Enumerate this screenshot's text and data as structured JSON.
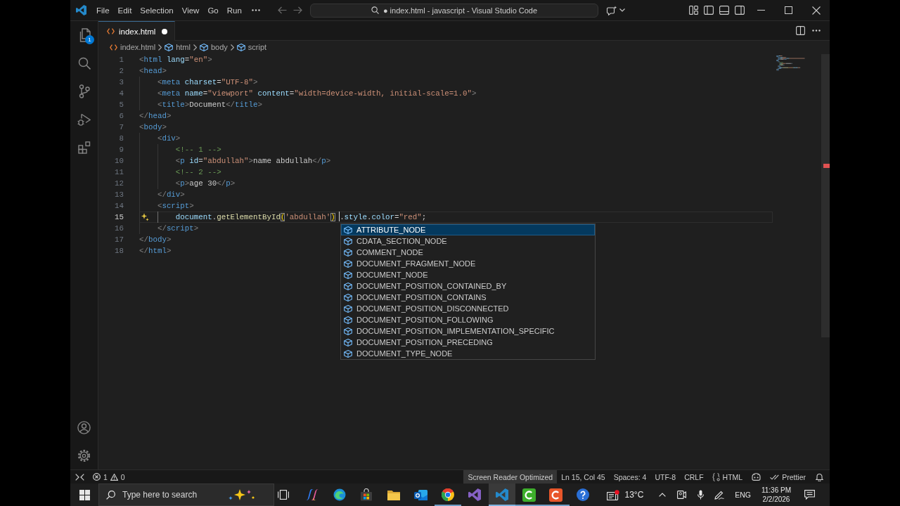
{
  "window": {
    "title": "● index.html - javascript - Visual Studio Code",
    "menu": [
      "File",
      "Edit",
      "Selection",
      "View",
      "Go",
      "Run"
    ]
  },
  "activity_bar": {
    "explorer_badge": "1"
  },
  "tabs": [
    {
      "label": "index.html",
      "selected": true,
      "modified": true
    }
  ],
  "breadcrumbs": [
    {
      "kind": "file",
      "label": "index.html"
    },
    {
      "kind": "element",
      "label": "html"
    },
    {
      "kind": "element",
      "label": "body"
    },
    {
      "kind": "element",
      "label": "script"
    }
  ],
  "editor": {
    "lines": [
      {
        "number": "1",
        "current": false,
        "code_action": false,
        "tokens": [
          {
            "kind": "punct",
            "text": "<"
          },
          {
            "kind": "tag",
            "text": "html"
          },
          {
            "kind": "attr",
            "text": " lang"
          },
          {
            "kind": "plain",
            "text": "="
          },
          {
            "kind": "string",
            "text": "\"en\""
          },
          {
            "kind": "punct",
            "text": ">"
          }
        ]
      },
      {
        "number": "2",
        "current": false,
        "code_action": false,
        "tokens": [
          {
            "kind": "punct",
            "text": "<"
          },
          {
            "kind": "tag",
            "text": "head"
          },
          {
            "kind": "punct",
            "text": ">"
          }
        ]
      },
      {
        "number": "3",
        "current": false,
        "code_action": false,
        "tokens": [
          {
            "kind": "punct",
            "text": "    <"
          },
          {
            "kind": "tag",
            "text": "meta"
          },
          {
            "kind": "attr",
            "text": " charset"
          },
          {
            "kind": "plain",
            "text": "="
          },
          {
            "kind": "string",
            "text": "\"UTF-8\""
          },
          {
            "kind": "punct",
            "text": ">"
          }
        ]
      },
      {
        "number": "4",
        "current": false,
        "code_action": false,
        "tokens": [
          {
            "kind": "punct",
            "text": "    <"
          },
          {
            "kind": "tag",
            "text": "meta"
          },
          {
            "kind": "attr",
            "text": " name"
          },
          {
            "kind": "plain",
            "text": "="
          },
          {
            "kind": "string",
            "text": "\"viewport\""
          },
          {
            "kind": "attr",
            "text": " content"
          },
          {
            "kind": "plain",
            "text": "="
          },
          {
            "kind": "string",
            "text": "\"width=device-width, initial-scale=1.0\""
          },
          {
            "kind": "punct",
            "text": ">"
          }
        ]
      },
      {
        "number": "5",
        "current": false,
        "code_action": false,
        "tokens": [
          {
            "kind": "punct",
            "text": "    <"
          },
          {
            "kind": "tag",
            "text": "title"
          },
          {
            "kind": "punct",
            "text": ">"
          },
          {
            "kind": "plain",
            "text": "Document"
          },
          {
            "kind": "punct",
            "text": "</"
          },
          {
            "kind": "tag",
            "text": "title"
          },
          {
            "kind": "punct",
            "text": ">"
          }
        ]
      },
      {
        "number": "6",
        "current": false,
        "code_action": false,
        "tokens": [
          {
            "kind": "punct",
            "text": "</"
          },
          {
            "kind": "tag",
            "text": "head"
          },
          {
            "kind": "punct",
            "text": ">"
          }
        ]
      },
      {
        "number": "7",
        "current": false,
        "code_action": false,
        "tokens": [
          {
            "kind": "punct",
            "text": "<"
          },
          {
            "kind": "tag",
            "text": "body"
          },
          {
            "kind": "punct",
            "text": ">"
          }
        ]
      },
      {
        "number": "8",
        "current": false,
        "code_action": false,
        "tokens": [
          {
            "kind": "punct",
            "text": "    <"
          },
          {
            "kind": "tag",
            "text": "div"
          },
          {
            "kind": "punct",
            "text": ">"
          }
        ]
      },
      {
        "number": "9",
        "current": false,
        "code_action": false,
        "tokens": [
          {
            "kind": "comment",
            "text": "        <!-- 1 -->"
          }
        ]
      },
      {
        "number": "10",
        "current": false,
        "code_action": false,
        "tokens": [
          {
            "kind": "punct",
            "text": "        <"
          },
          {
            "kind": "tag",
            "text": "p"
          },
          {
            "kind": "attr",
            "text": " id"
          },
          {
            "kind": "plain",
            "text": "="
          },
          {
            "kind": "string",
            "text": "\"abdullah\""
          },
          {
            "kind": "punct",
            "text": ">"
          },
          {
            "kind": "plain",
            "text": "name abdullah"
          },
          {
            "kind": "punct",
            "text": "</"
          },
          {
            "kind": "tag",
            "text": "p"
          },
          {
            "kind": "punct",
            "text": ">"
          }
        ]
      },
      {
        "number": "11",
        "current": false,
        "code_action": false,
        "tokens": [
          {
            "kind": "comment",
            "text": "        <!-- 2 -->"
          }
        ]
      },
      {
        "number": "12",
        "current": false,
        "code_action": false,
        "tokens": [
          {
            "kind": "punct",
            "text": "        <"
          },
          {
            "kind": "tag",
            "text": "p"
          },
          {
            "kind": "punct",
            "text": ">"
          },
          {
            "kind": "plain",
            "text": "age 30"
          },
          {
            "kind": "punct",
            "text": "</"
          },
          {
            "kind": "tag",
            "text": "p"
          },
          {
            "kind": "punct",
            "text": ">"
          }
        ]
      },
      {
        "number": "13",
        "current": false,
        "code_action": false,
        "tokens": [
          {
            "kind": "punct",
            "text": "    </"
          },
          {
            "kind": "tag",
            "text": "div"
          },
          {
            "kind": "punct",
            "text": ">"
          }
        ]
      },
      {
        "number": "14",
        "current": false,
        "code_action": false,
        "tokens": [
          {
            "kind": "punct",
            "text": "    <"
          },
          {
            "kind": "tag",
            "text": "script"
          },
          {
            "kind": "punct",
            "text": ">"
          }
        ]
      },
      {
        "number": "15",
        "current": true,
        "code_action": true,
        "tokens": [
          {
            "kind": "var",
            "text": "        document"
          },
          {
            "kind": "plain",
            "text": "."
          },
          {
            "kind": "func",
            "text": "getElementById"
          },
          {
            "kind": "match",
            "text": "("
          },
          {
            "kind": "string",
            "text": "'abdullah'"
          },
          {
            "kind": "match",
            "text": ")"
          },
          {
            "kind": "cursor"
          },
          {
            "kind": "plain",
            "text": "."
          },
          {
            "kind": "var",
            "text": "style"
          },
          {
            "kind": "plain",
            "text": "."
          },
          {
            "kind": "var",
            "text": "color"
          },
          {
            "kind": "plain",
            "text": "="
          },
          {
            "kind": "string",
            "text": "\"red\""
          },
          {
            "kind": "plain",
            "text": ";"
          }
        ]
      },
      {
        "number": "16",
        "current": false,
        "code_action": false,
        "tokens": [
          {
            "kind": "punct",
            "text": "    </"
          },
          {
            "kind": "tag",
            "text": "script"
          },
          {
            "kind": "punct",
            "text": ">"
          }
        ]
      },
      {
        "number": "17",
        "current": false,
        "code_action": false,
        "tokens": [
          {
            "kind": "punct",
            "text": "</"
          },
          {
            "kind": "tag",
            "text": "body"
          },
          {
            "kind": "punct",
            "text": ">"
          }
        ]
      },
      {
        "number": "18",
        "current": false,
        "code_action": false,
        "tokens": [
          {
            "kind": "punct",
            "text": "</"
          },
          {
            "kind": "tag",
            "text": "html"
          },
          {
            "kind": "punct",
            "text": ">"
          }
        ]
      }
    ],
    "suggestions": [
      {
        "label": "ATTRIBUTE_NODE",
        "selected": true
      },
      {
        "label": "CDATA_SECTION_NODE",
        "selected": false
      },
      {
        "label": "COMMENT_NODE",
        "selected": false
      },
      {
        "label": "DOCUMENT_FRAGMENT_NODE",
        "selected": false
      },
      {
        "label": "DOCUMENT_NODE",
        "selected": false
      },
      {
        "label": "DOCUMENT_POSITION_CONTAINED_BY",
        "selected": false
      },
      {
        "label": "DOCUMENT_POSITION_CONTAINS",
        "selected": false
      },
      {
        "label": "DOCUMENT_POSITION_DISCONNECTED",
        "selected": false
      },
      {
        "label": "DOCUMENT_POSITION_FOLLOWING",
        "selected": false
      },
      {
        "label": "DOCUMENT_POSITION_IMPLEMENTATION_SPECIFIC",
        "selected": false
      },
      {
        "label": "DOCUMENT_POSITION_PRECEDING",
        "selected": false
      },
      {
        "label": "DOCUMENT_TYPE_NODE",
        "selected": false
      }
    ]
  },
  "status_bar": {
    "errors": "1",
    "warnings": "0",
    "items": [
      {
        "kind": "mode",
        "label": "Screen Reader Optimized"
      },
      {
        "kind": "text",
        "label": "Ln 15, Col 45"
      },
      {
        "kind": "text",
        "label": "Spaces: 4"
      },
      {
        "kind": "text",
        "label": "UTF-8"
      },
      {
        "kind": "text",
        "label": "CRLF"
      },
      {
        "kind": "language",
        "label": "HTML"
      },
      {
        "kind": "copilot"
      },
      {
        "kind": "formatter",
        "label": "Prettier"
      },
      {
        "kind": "bell"
      }
    ]
  },
  "taskbar": {
    "search": {
      "placeholder": "Type here to search"
    },
    "apps": [
      {
        "kind": "taskview",
        "running": false,
        "selected": false
      },
      {
        "kind": "ribbon",
        "running": false,
        "selected": false
      },
      {
        "kind": "wave",
        "running": false,
        "selected": false
      },
      {
        "kind": "bag",
        "running": false,
        "selected": false
      },
      {
        "kind": "folder",
        "running": false,
        "selected": false
      },
      {
        "kind": "mail",
        "running": false,
        "selected": false
      },
      {
        "kind": "wheel",
        "running": true,
        "selected": false
      },
      {
        "kind": "infinity",
        "running": false,
        "selected": false
      },
      {
        "kind": "editor",
        "running": true,
        "selected": true
      },
      {
        "kind": "studio",
        "running": true,
        "selected": false
      },
      {
        "kind": "recorder",
        "running": true,
        "selected": false
      },
      {
        "kind": "help",
        "running": false,
        "selected": false
      }
    ],
    "weather": "13°C",
    "language": "ENG",
    "time": "11:36 PM",
    "date": "2/2/2026"
  }
}
